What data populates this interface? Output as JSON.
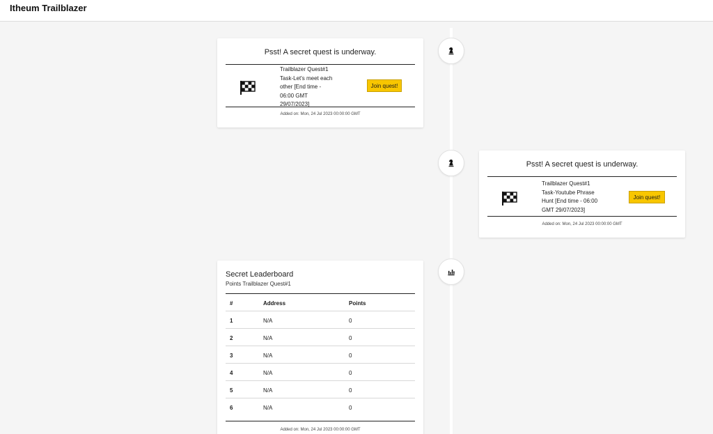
{
  "app": {
    "title": "Itheum Trailblazer"
  },
  "icons": {
    "quest_node": "chess-knight-icon",
    "leaderboard_node": "bar-chart-icon",
    "flag": "checkered-flag-icon"
  },
  "colors": {
    "join_button": "#f8c600"
  },
  "quests": [
    {
      "heading": "Psst! A secret quest is underway.",
      "line1": "Trailblazer Quest#1",
      "line2": "Task-Let's meet each",
      "line3": "other [End time -",
      "line4": "06:00 GMT",
      "line5": "29/07/2023]",
      "button": "Join quest!",
      "added": "Added on: Mon, 24 Jul 2023 00:00:00 GMT"
    },
    {
      "heading": "Psst! A secret quest is underway.",
      "line1": "Trailblazer Quest#1",
      "line2": "Task-Youtube Phrase",
      "line3": "Hunt [End time - 06:00",
      "line4": "GMT 29/07/2023]",
      "button": "Join quest!",
      "added": "Added on: Mon, 24 Jul 2023 00:00:00 GMT"
    }
  ],
  "leaderboard": {
    "title": "Secret Leaderboard",
    "subtitle": "Points Trailblazer Quest#1",
    "columns": {
      "rank": "#",
      "address": "Address",
      "points": "Points"
    },
    "rows": [
      {
        "rank": "1",
        "address": "N/A",
        "points": "0"
      },
      {
        "rank": "2",
        "address": "N/A",
        "points": "0"
      },
      {
        "rank": "3",
        "address": "N/A",
        "points": "0"
      },
      {
        "rank": "4",
        "address": "N/A",
        "points": "0"
      },
      {
        "rank": "5",
        "address": "N/A",
        "points": "0"
      },
      {
        "rank": "6",
        "address": "N/A",
        "points": "0"
      }
    ],
    "added": "Added on: Mon, 24 Jul 2023 00:00:00 GMT"
  }
}
